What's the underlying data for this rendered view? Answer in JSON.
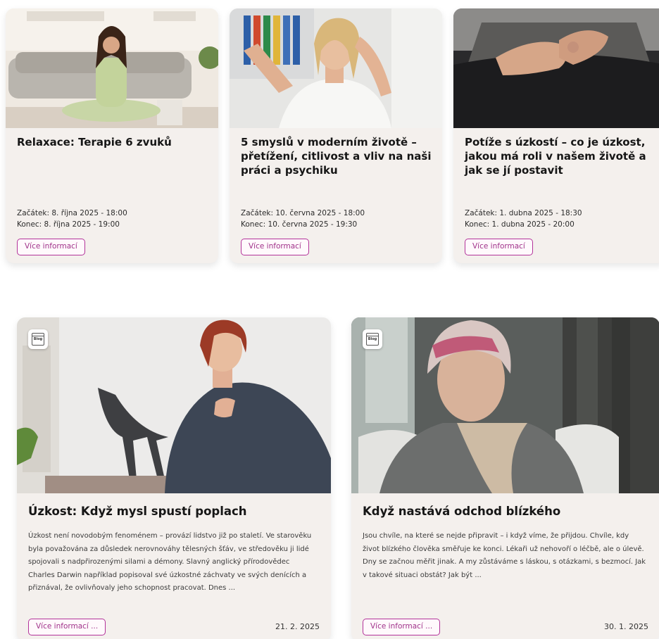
{
  "events": [
    {
      "title": "Relaxace: Terapie 6 zvuků",
      "start": "Začátek: 8. října 2025 - 18:00",
      "end": "Konec: 8. října 2025 - 19:00",
      "button": "Více informací",
      "image_icon": "woman-meditating-photo"
    },
    {
      "title": "5 smyslů v moderním životě – přetížení, citlivost a vliv na naši práci a psychiku",
      "start": "Začátek: 10. června 2025 - 18:00",
      "end": "Konec: 10. června 2025 - 19:30",
      "button": "Více informací",
      "image_icon": "stressed-woman-photo"
    },
    {
      "title": "Potíže s úzkostí – co je úzkost, jakou má roli v našem životě a jak se jí postavit",
      "start": "Začátek: 1. dubna 2025 - 18:30",
      "end": "Konec: 1. dubna 2025 - 20:00",
      "button": "Více informací",
      "image_icon": "clasped-hands-photo"
    }
  ],
  "posts": [
    {
      "badge": "Blog",
      "title": "Úzkost: Když mysl spustí poplach",
      "excerpt": "Úzkost není novodobým fenoménem – provází lidstvo již po staletí. Ve starověku byla považována za důsledek nerovnováhy tělesných šťáv, ve středověku ji lidé spojovali s nadpřirozenými silami a démony. Slavný anglický přírodovědec Charles Darwin například popisoval své úzkostné záchvaty ve svých denících a přiznával, že ovlivňovaly jeho schopnost pracovat. Dnes ...",
      "button": "Více informací ...",
      "date": "21. 2. 2025",
      "image_icon": "anxious-woman-photo"
    },
    {
      "badge": "Blog",
      "title": "Když nastává odchod blízkého",
      "excerpt": "Jsou chvíle, na které se nejde připravit – i když víme, že přijdou. Chvíle, kdy život blízkého člověka směřuje ke konci. Lékaři už nehovoří o léčbě, ale o úlevě. Dny se začnou měřit jinak. A my zůstáváme s láskou, s otázkami, s bezmocí. Jak v takové situaci obstát? Jak být ...",
      "button": "Více informací ...",
      "date": "30. 1. 2025",
      "image_icon": "elderly-patient-photo"
    }
  ],
  "colors": {
    "card_bg": "#f4f0ed",
    "accent": "#b3339a",
    "title": "#161616"
  }
}
